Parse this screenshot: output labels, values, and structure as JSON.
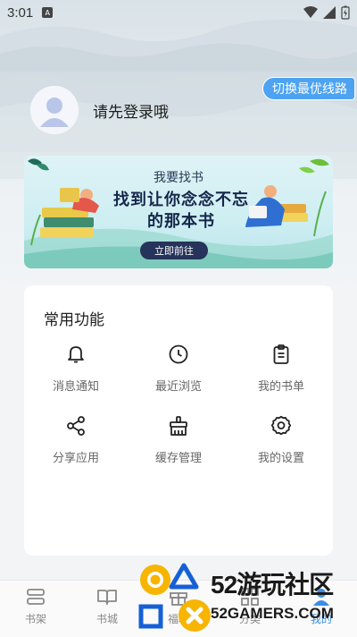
{
  "status_bar": {
    "time": "3:01",
    "notification_badge": "A"
  },
  "header": {
    "switch_route_label": "切换最优线路",
    "login_prompt": "请先登录哦"
  },
  "banner": {
    "subtitle": "我要找书",
    "title_line1": "找到让你念念不忘",
    "title_line2": "的那本书",
    "button_label": "立即前往"
  },
  "functions": {
    "title": "常用功能",
    "items": [
      {
        "label": "消息通知",
        "icon": "bell-icon"
      },
      {
        "label": "最近浏览",
        "icon": "clock-icon"
      },
      {
        "label": "我的书单",
        "icon": "clipboard-icon"
      },
      {
        "label": "分享应用",
        "icon": "share-icon"
      },
      {
        "label": "缓存管理",
        "icon": "broom-icon"
      },
      {
        "label": "我的设置",
        "icon": "gear-icon"
      }
    ]
  },
  "tabbar": {
    "tabs": [
      {
        "label": "书架",
        "icon": "bookshelf-icon",
        "active": false
      },
      {
        "label": "书城",
        "icon": "open-book-icon",
        "active": false
      },
      {
        "label": "福利",
        "icon": "gift-icon",
        "active": false
      },
      {
        "label": "分类",
        "icon": "grid-icon",
        "active": false
      },
      {
        "label": "我的",
        "icon": "person-icon",
        "active": true
      }
    ]
  },
  "watermark": {
    "text_main": "52游玩社区",
    "text_sub": "52GAMERS.COM"
  },
  "colors": {
    "accent": "#4da3f2",
    "tab_active": "#3a8ee6",
    "banner_button": "#26335a"
  }
}
